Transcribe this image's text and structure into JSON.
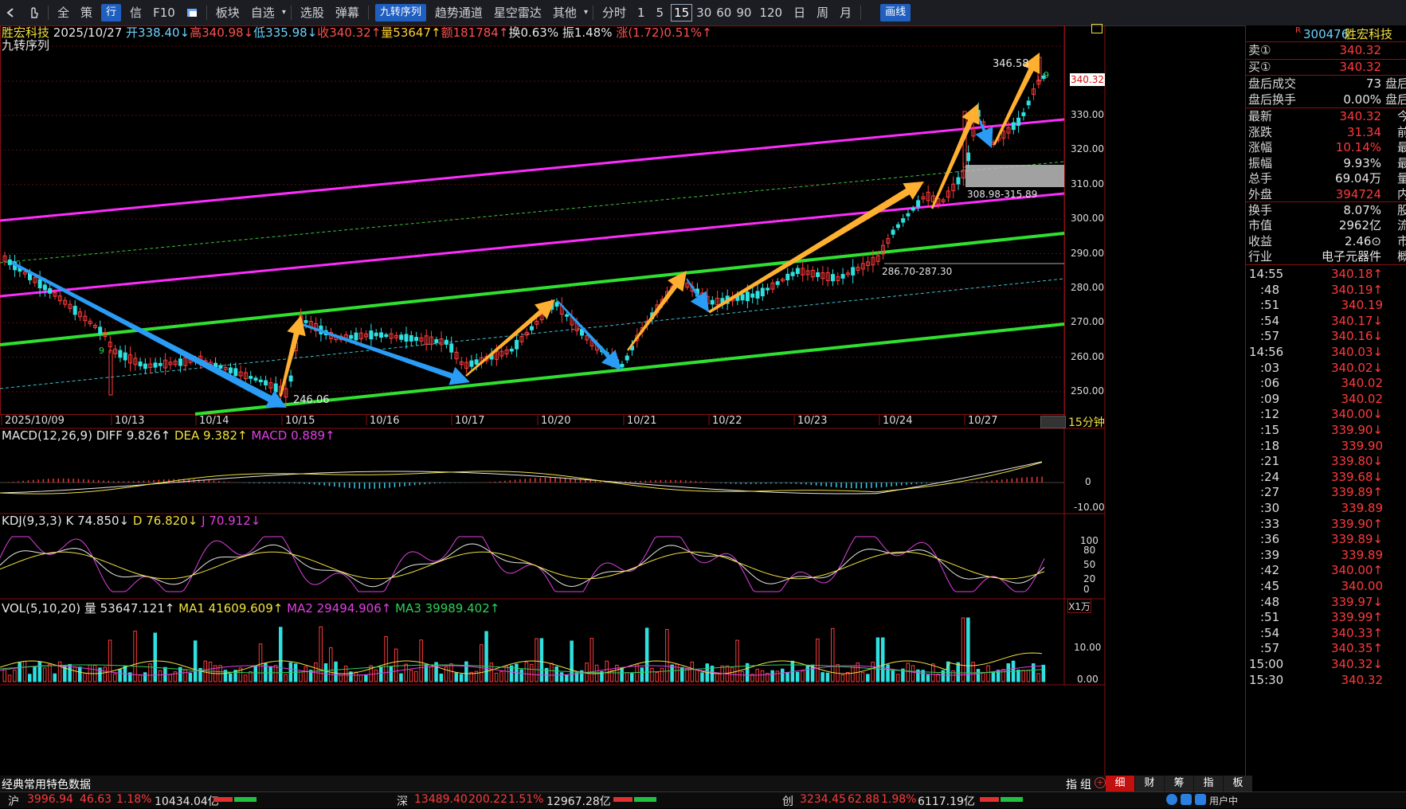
{
  "toolbar": {
    "back_icon": "back-arrow-icon",
    "pointer_icon": "hand-pointer-icon",
    "items": [
      "全",
      "策",
      "行",
      "信",
      "F10",
      "",
      "板块",
      "自选",
      "选股",
      "弹幕",
      "九转序列",
      "趋势通道",
      "星空雷达",
      "其他",
      "分时",
      "1",
      "5",
      "15",
      "30",
      "60",
      "90",
      "120",
      "日",
      "周",
      "月",
      "画线"
    ],
    "active_period": "15",
    "active_tool": "九转序列",
    "draw_button": "画线"
  },
  "header": {
    "stock_name": "胜宏科技",
    "date": "2025/10/27",
    "open": "开338.40↓",
    "high": "高340.98↓",
    "low": "低335.98↓",
    "close": "收340.32↑",
    "volume": "量53647↑",
    "amount": "额181784↑",
    "turnover": "换0.63%",
    "amplitude": "振1.48%",
    "change": "涨(1.72)0.51%↑",
    "indicator": "九转序列"
  },
  "main_chart": {
    "price_ticks": [
      "330.00",
      "320.00",
      "310.00",
      "300.00",
      "290.00",
      "280.00",
      "270.00",
      "260.00",
      "250.00"
    ],
    "current_price_tag": "340.32",
    "dates": [
      "2025/10/09",
      "10/13",
      "10/14",
      "10/15",
      "10/16",
      "10/17",
      "10/20",
      "10/21",
      "10/22",
      "10/23",
      "10/24",
      "10/27"
    ],
    "period_label": "15分钟",
    "annotations": {
      "high_label": "346.58",
      "low_label": "246.06",
      "zone_upper": "308.98-315.89",
      "zone_lower": "286.70-287.30",
      "nine_top": "9",
      "nine_left": "9"
    }
  },
  "macd": {
    "title": "MACD(12,26,9)",
    "diff": "DIFF 9.826↑",
    "dea": "DEA 9.382↑",
    "macd": "MACD 0.889↑",
    "ticks": [
      "0",
      "-10.00"
    ]
  },
  "kdj": {
    "title": "KDJ(9,3,3)",
    "k": "K 74.850↓",
    "d": "D 76.820↓",
    "j": "J 70.912↓",
    "ticks": [
      "100",
      "80",
      "50",
      "20",
      "0"
    ]
  },
  "vol": {
    "title": "VOL(5,10,20)",
    "v": "量 53647.121↑",
    "ma1": "MA1 41609.609↑",
    "ma2": "MA2 29494.906↑",
    "ma3": "MA3 39989.402↑",
    "unit": "X1万",
    "ticks": [
      "10.00",
      "0.00"
    ]
  },
  "right_panel": {
    "code": "300476",
    "name": "胜宏科技",
    "flag": "R",
    "sell_label": "卖①",
    "sell_price": "340.32",
    "buy_label": "买①",
    "buy_price": "340.32",
    "after_vol_label": "盘后成交",
    "after_vol": "73",
    "after_vol_right": "盘后金",
    "after_turn_label": "盘后换手",
    "after_turn": "0.00%",
    "after_turn_right": "盘后笔",
    "stats": [
      {
        "l": "最新",
        "v": "340.32",
        "r": "今开",
        "c": "red"
      },
      {
        "l": "涨跌",
        "v": "31.34",
        "r": "前收",
        "c": "red"
      },
      {
        "l": "涨幅",
        "v": "10.14%",
        "r": "最高",
        "c": "red"
      },
      {
        "l": "振幅",
        "v": "9.93%",
        "r": "最低",
        "c": "white"
      },
      {
        "l": "总手",
        "v": "69.04万",
        "r": "量比",
        "c": "white"
      },
      {
        "l": "外盘",
        "v": "394724",
        "r": "内盘",
        "c": "red"
      },
      {
        "l": "换手",
        "v": "8.07%",
        "r": "股本",
        "c": "white"
      },
      {
        "l": "市值",
        "v": "2962亿",
        "r": "流通",
        "c": "white"
      },
      {
        "l": "收益",
        "v": "2.46⊙",
        "r": "市盈",
        "c": "white"
      },
      {
        "l": "行业",
        "v": "电子元器件",
        "r": "概念",
        "c": "white"
      }
    ],
    "ticks": [
      {
        "t": "14:55",
        "p": "340.18↑",
        "c": "red"
      },
      {
        "t": ":48",
        "p": "340.19↑",
        "c": "red"
      },
      {
        "t": ":51",
        "p": "340.19",
        "c": "red"
      },
      {
        "t": ":54",
        "p": "340.17↓",
        "c": "red"
      },
      {
        "t": ":57",
        "p": "340.16↓",
        "c": "red"
      },
      {
        "t": "14:56",
        "p": "340.03↓",
        "c": "red"
      },
      {
        "t": ":03",
        "p": "340.02↓",
        "c": "red"
      },
      {
        "t": ":06",
        "p": "340.02",
        "c": "red"
      },
      {
        "t": ":09",
        "p": "340.02",
        "c": "red"
      },
      {
        "t": ":12",
        "p": "340.00↓",
        "c": "red"
      },
      {
        "t": ":15",
        "p": "339.90↓",
        "c": "red"
      },
      {
        "t": ":18",
        "p": "339.90",
        "c": "red"
      },
      {
        "t": ":21",
        "p": "339.80↓",
        "c": "red"
      },
      {
        "t": ":24",
        "p": "339.68↓",
        "c": "red"
      },
      {
        "t": ":27",
        "p": "339.89↑",
        "c": "red"
      },
      {
        "t": ":30",
        "p": "339.89",
        "c": "red"
      },
      {
        "t": ":33",
        "p": "339.90↑",
        "c": "red"
      },
      {
        "t": ":36",
        "p": "339.89↓",
        "c": "red"
      },
      {
        "t": ":39",
        "p": "339.89",
        "c": "red"
      },
      {
        "t": ":42",
        "p": "340.00↑",
        "c": "red"
      },
      {
        "t": ":45",
        "p": "340.00",
        "c": "red"
      },
      {
        "t": ":48",
        "p": "339.97↓",
        "c": "red"
      },
      {
        "t": ":51",
        "p": "339.99↑",
        "c": "red"
      },
      {
        "t": ":54",
        "p": "340.33↑",
        "c": "red"
      },
      {
        "t": ":57",
        "p": "340.35↑",
        "c": "red"
      },
      {
        "t": "15:00",
        "p": "340.32↓",
        "c": "red"
      },
      {
        "t": "15:30",
        "p": "340.32",
        "c": "red"
      }
    ],
    "tabs": [
      "细",
      "财",
      "筹",
      "指",
      "板"
    ]
  },
  "bottom": {
    "tabs": [
      "经典常用",
      "特色数据"
    ],
    "right_label": "指",
    "right_label2": "组",
    "sh": {
      "name": "沪",
      "idx": "3996.94",
      "chg": "46.63",
      "pct": "1.18%",
      "amt": "10434.04亿"
    },
    "sz": {
      "name": "深",
      "idx": "13489.40",
      "chg": "200.22",
      "pct": "1.51%",
      "amt": "12967.28亿"
    },
    "cy": {
      "name": "创",
      "idx": "3234.45",
      "chg": "62.88",
      "pct": "1.98%",
      "amt": "6117.19亿"
    },
    "user": "用户中"
  }
}
